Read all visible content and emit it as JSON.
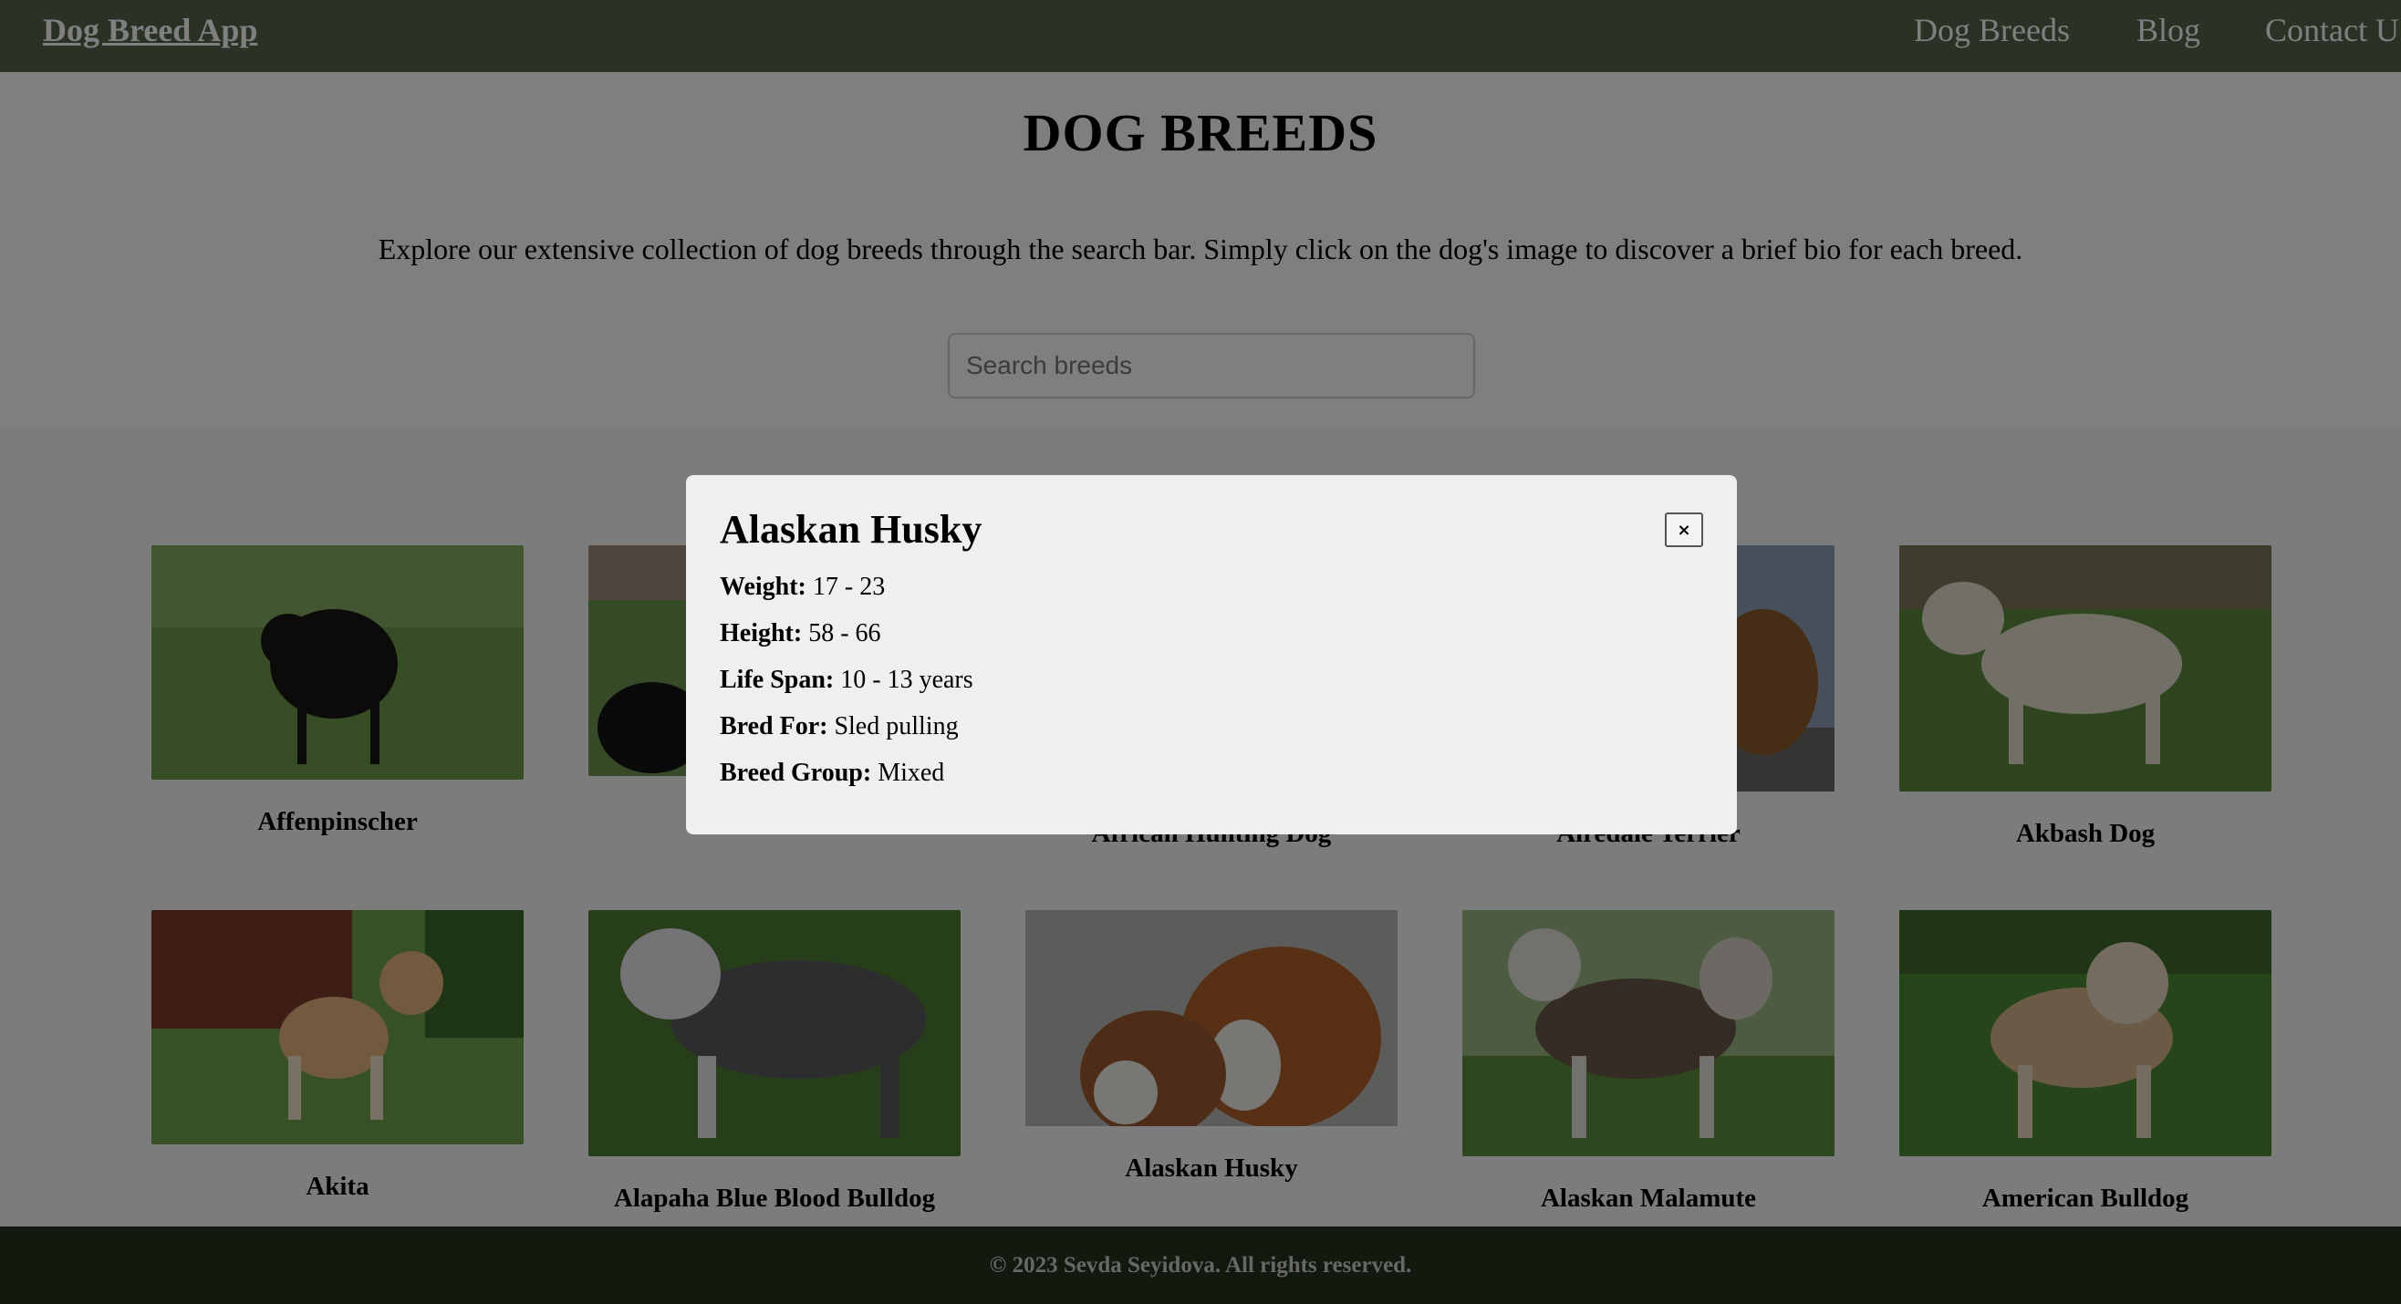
{
  "header": {
    "brand": "Dog Breed App",
    "nav": [
      "Dog Breeds",
      "Blog",
      "Contact U"
    ]
  },
  "main": {
    "title": "DOG BREEDS",
    "intro": "Explore our extensive collection of dog breeds through the search bar. Simply click on the dog's image to discover a brief bio for each breed.",
    "search_placeholder": "Search breeds"
  },
  "cards": [
    {
      "name": "Affenpinscher"
    },
    {
      "name": ""
    },
    {
      "name": "African Hunting Dog"
    },
    {
      "name": "Airedale Terrier"
    },
    {
      "name": "Akbash Dog"
    },
    {
      "name": "Akita"
    },
    {
      "name": "Alapaha Blue Blood Bulldog"
    },
    {
      "name": "Alaskan Husky"
    },
    {
      "name": "Alaskan Malamute"
    },
    {
      "name": "American Bulldog"
    }
  ],
  "modal": {
    "title": "Alaskan Husky",
    "close_label": "×",
    "fields": [
      {
        "label": "Weight:",
        "value": "17 - 23"
      },
      {
        "label": "Height:",
        "value": "58 - 66"
      },
      {
        "label": "Life Span:",
        "value": "10 - 13 years"
      },
      {
        "label": "Bred For:",
        "value": "Sled pulling"
      },
      {
        "label": "Breed Group:",
        "value": "Mixed"
      }
    ]
  },
  "footer": {
    "copyright": "© 2023 Sevda Seyidova. All rights reserved."
  }
}
